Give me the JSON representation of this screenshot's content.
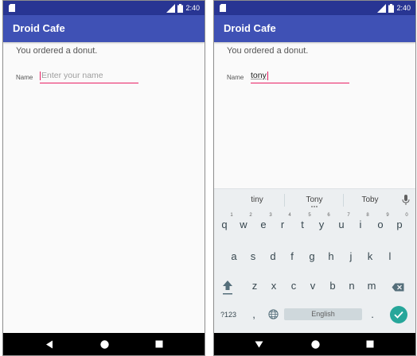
{
  "status_bar": {
    "time": "2:40"
  },
  "app": {
    "title": "Droid Cafe",
    "primary_color": "#3f51b5",
    "status_bar_color": "#283593",
    "accent_color": "#e91e63"
  },
  "order": {
    "message": "You ordered a donut."
  },
  "name_form": {
    "label": "Name",
    "placeholder": "Enter your name",
    "value": "tony"
  },
  "keyboard": {
    "suggestions": [
      "tiny",
      "Tony",
      "Toby"
    ],
    "row1": [
      {
        "key": "q",
        "hint": "1"
      },
      {
        "key": "w",
        "hint": "2"
      },
      {
        "key": "e",
        "hint": "3"
      },
      {
        "key": "r",
        "hint": "4"
      },
      {
        "key": "t",
        "hint": "5"
      },
      {
        "key": "y",
        "hint": "6"
      },
      {
        "key": "u",
        "hint": "7"
      },
      {
        "key": "i",
        "hint": "8"
      },
      {
        "key": "o",
        "hint": "9"
      },
      {
        "key": "p",
        "hint": "0"
      }
    ],
    "row2": [
      "a",
      "s",
      "d",
      "f",
      "g",
      "h",
      "j",
      "k",
      "l"
    ],
    "row3": [
      "z",
      "x",
      "c",
      "v",
      "b",
      "n",
      "m"
    ],
    "symbols_label": "?123",
    "comma": ",",
    "space_label": "English",
    "period": ".",
    "enter_color": "#26a69a",
    "icons": [
      "shift-icon",
      "backspace-icon",
      "globe-icon",
      "microphone-icon",
      "check-icon"
    ]
  },
  "nav_icons": [
    "back-icon",
    "home-icon",
    "recents-icon"
  ]
}
